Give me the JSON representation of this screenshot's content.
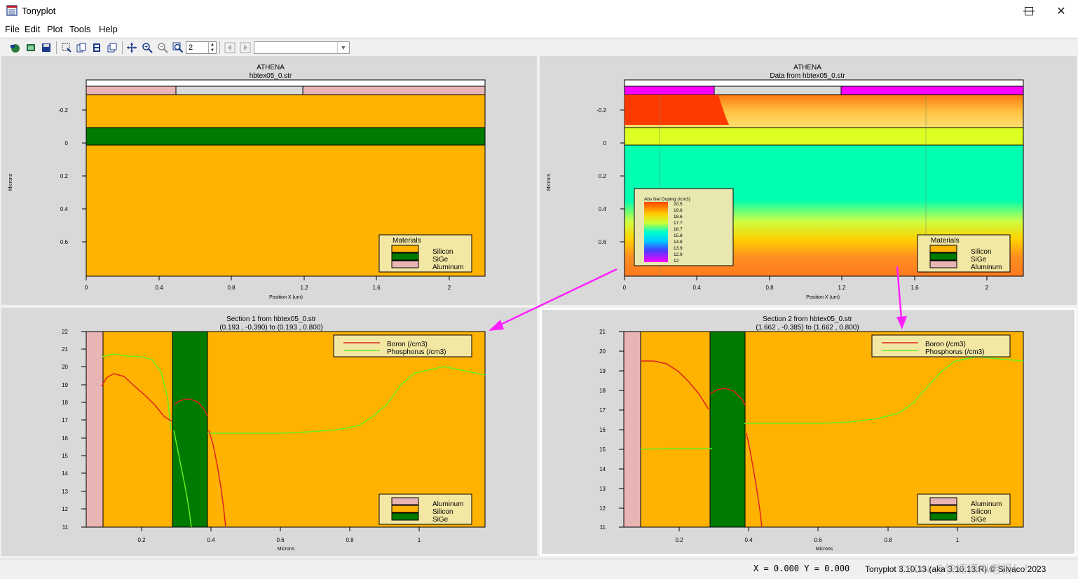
{
  "window": {
    "title": "Tonyplot"
  },
  "menu": {
    "file": "File",
    "edit": "Edit",
    "plot": "Plot",
    "tools": "Tools",
    "help": "Help"
  },
  "toolbar": {
    "zoom_value": "2",
    "combo_value": ""
  },
  "colors": {
    "silicon": "#ffb300",
    "sige": "#007a00",
    "aluminum": "#e8b4b4",
    "arrow": "#ff22ff",
    "boron": "#dd2222",
    "phosphorus": "#66ee22"
  },
  "panel1": {
    "title1": "ATHENA",
    "title2": "hbtex05_0.str",
    "ylabel": "Microns",
    "xlabel": "Position X (um)",
    "yticks": [
      "-0.2",
      "0",
      "0.2",
      "0.4",
      "0.6"
    ],
    "xticks": [
      "0",
      "0.4",
      "0.8",
      "1.2",
      "1.6",
      "2"
    ],
    "legend": {
      "title": "Materials",
      "items": [
        "Silicon",
        "SiGe",
        "Aluminum"
      ]
    }
  },
  "panel2": {
    "title1": "ATHENA",
    "title2": "Data from hbtex05_0.str",
    "ylabel": "Microns",
    "xlabel": "Position X (um)",
    "yticks": [
      "-0.2",
      "0",
      "0.2",
      "0.4",
      "0.6"
    ],
    "xticks": [
      "0",
      "0.4",
      "0.8",
      "1.2",
      "1.6",
      "2"
    ],
    "doping_legend": {
      "title": "Abs Net Doping (/cm3)",
      "levels": [
        "20.5",
        "19.6",
        "18.6",
        "17.7",
        "16.7",
        "15.8",
        "14.8",
        "13.9",
        "12.9",
        "12"
      ]
    },
    "legend": {
      "title": "Materials",
      "items": [
        "Silicon",
        "SiGe",
        "Aluminum"
      ]
    }
  },
  "panel3": {
    "title1": "Section 1 from hbtex05_0.str",
    "title2": "(0.193 , -0.390) to (0.193 , 0.800)",
    "xlabel": "Microns",
    "yticks": [
      "22",
      "21",
      "20",
      "19",
      "18",
      "17",
      "16",
      "15",
      "14",
      "13",
      "12",
      "11"
    ],
    "xticks": [
      "0.2",
      "0.4",
      "0.6",
      "0.8",
      "1"
    ],
    "series_legend": [
      "Boron (/cm3)",
      "Phosphorus (/cm3)"
    ],
    "legend": {
      "items": [
        "Aluminum",
        "Silicon",
        "SiGe"
      ]
    }
  },
  "panel4": {
    "title1": "Section 2 from hbtex05_0.str",
    "title2": "(1.662 , -0.385) to (1.662 , 0.800)",
    "xlabel": "Microns",
    "yticks": [
      "21",
      "20",
      "19",
      "18",
      "17",
      "16",
      "15",
      "14",
      "13",
      "12",
      "11"
    ],
    "xticks": [
      "0.2",
      "0.4",
      "0.6",
      "0.8",
      "1"
    ],
    "series_legend": [
      "Boron (/cm3)",
      "Phosphorus (/cm3)"
    ],
    "legend": {
      "items": [
        "Aluminum",
        "Silicon",
        "SiGe"
      ]
    }
  },
  "status": {
    "coords": "X = 0.000 Y = 0.000",
    "version": "Tonyplot 3.10.13 (aka 3.10.13.R) © Silvaco 2023",
    "watermark": "CSDN @快速模拟老祖！！！"
  }
}
